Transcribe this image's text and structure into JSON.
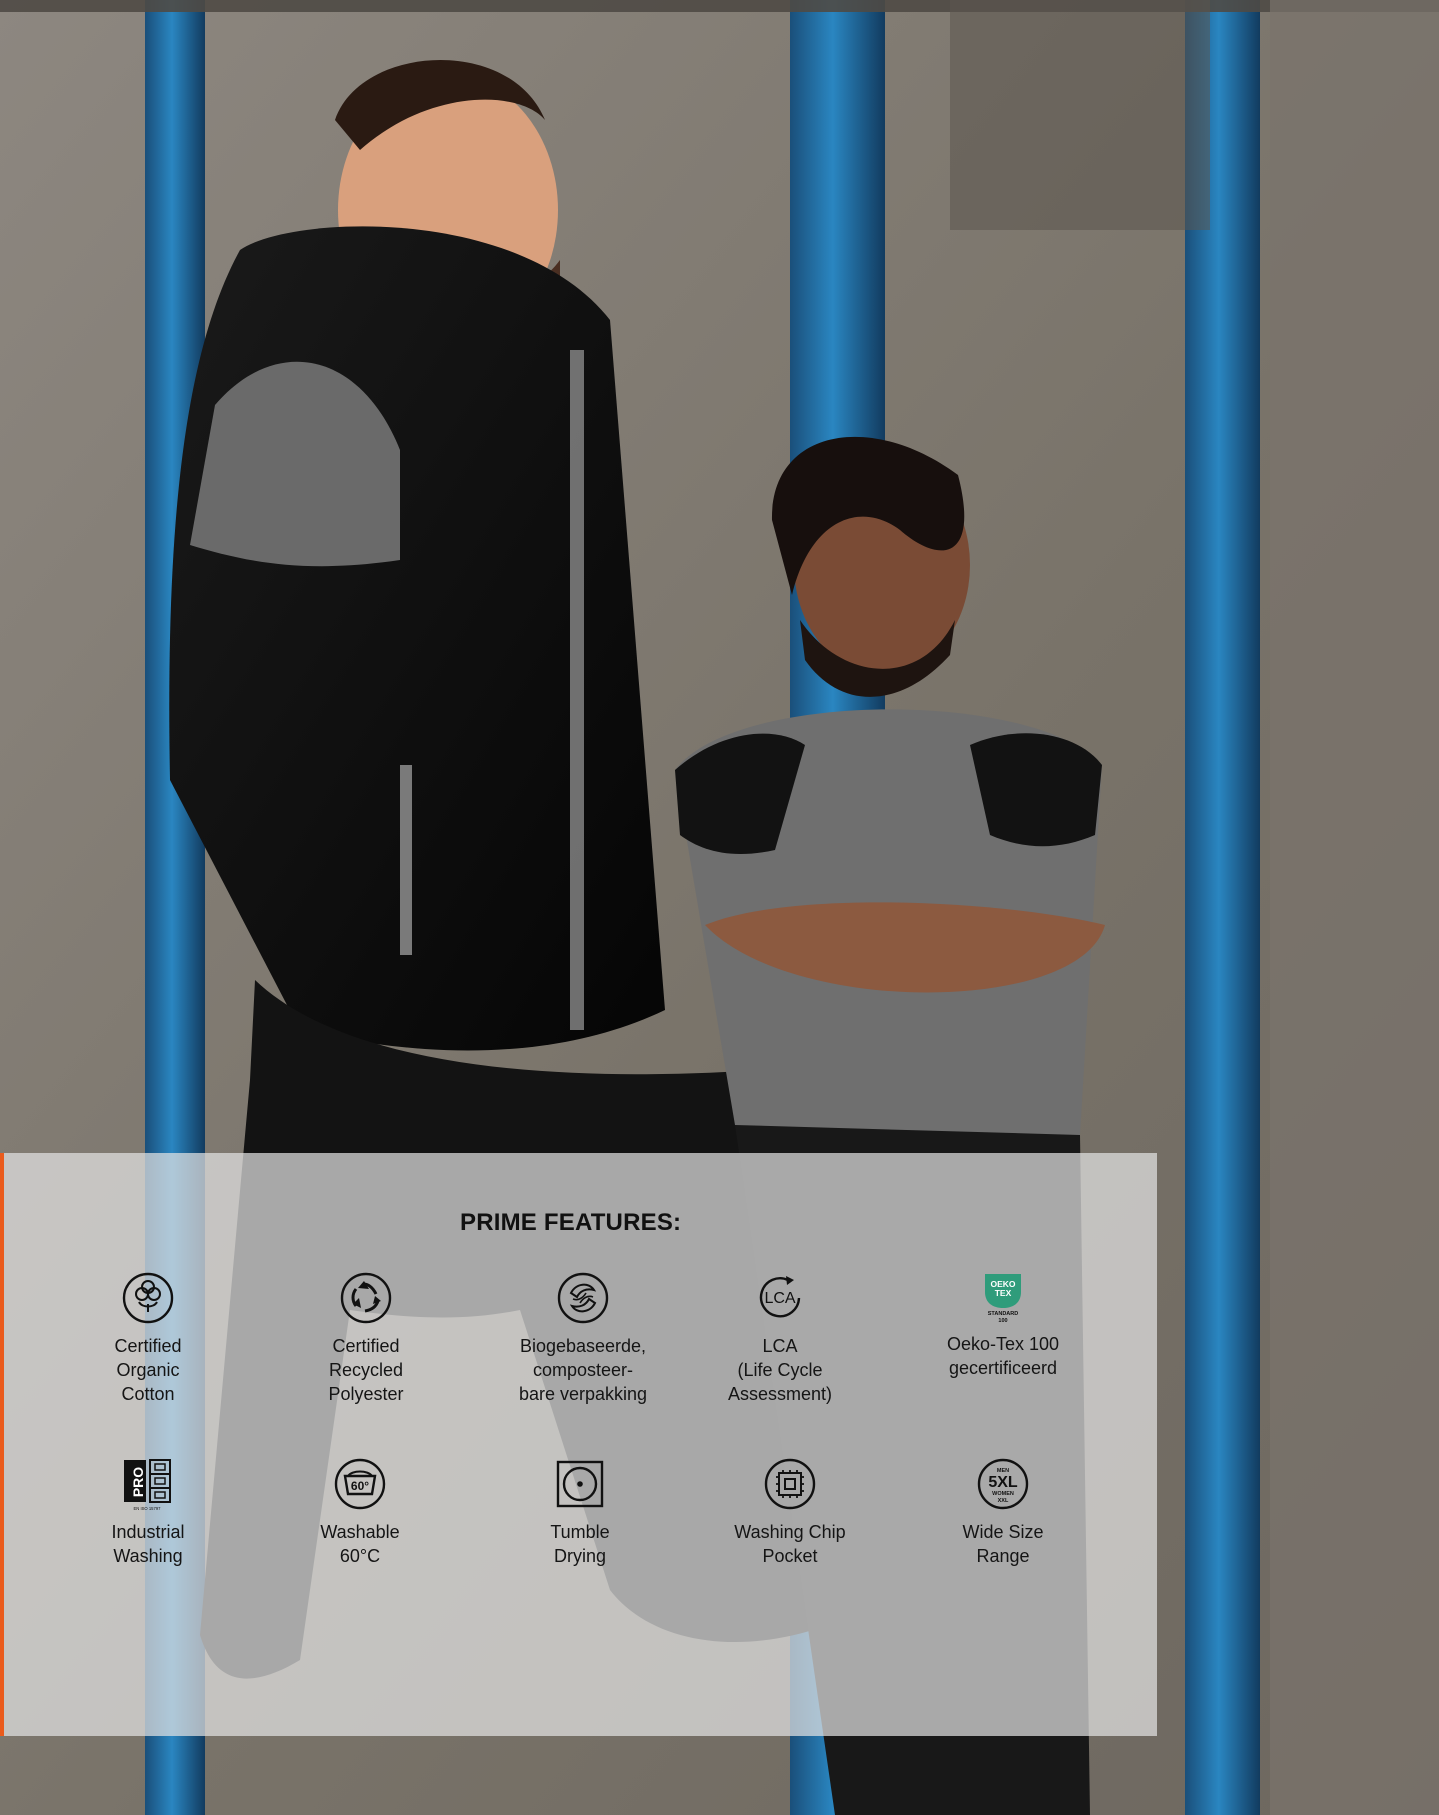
{
  "panel": {
    "title": "PRIME FEATURES:"
  },
  "features": [
    {
      "icon": "organic-cotton-icon",
      "label": "Certified\nOrganic\nCotton"
    },
    {
      "icon": "recycled-polyester-icon",
      "label": "Certified\nRecycled\nPolyester"
    },
    {
      "icon": "biobased-packaging-icon",
      "label": "Biogebaseerde,\ncomposteer-\nbare verpakking"
    },
    {
      "icon": "lca-icon",
      "label": "LCA\n(Life Cycle\nAssessment)"
    },
    {
      "icon": "oeko-tex-icon",
      "label": "Oeko-Tex 100\ngecertificeerd"
    },
    {
      "icon": "industrial-washing-icon",
      "label": "Industrial\nWashing"
    },
    {
      "icon": "washable-60-icon",
      "label": "Washable\n60°C"
    },
    {
      "icon": "tumble-drying-icon",
      "label": "Tumble\nDrying"
    },
    {
      "icon": "washing-chip-pocket-icon",
      "label": "Washing Chip\nPocket"
    },
    {
      "icon": "wide-size-range-icon",
      "label": "Wide Size\nRange"
    }
  ],
  "icon_text": {
    "lca": "LCA",
    "oeko_line1": "OEKO",
    "oeko_line2": "TEX",
    "oeko_line3": "STANDARD",
    "oeko_line4": "100",
    "pro": "PRO",
    "pro_norm": "EN ISO 15797",
    "temp": "60°",
    "size_top": "MEN",
    "size_main": "5XL",
    "size_mid": "WOMEN",
    "size_bottom": "XXL"
  },
  "colors": {
    "accent": "#ea5b1c",
    "oeko_green": "#2f9c7b"
  }
}
